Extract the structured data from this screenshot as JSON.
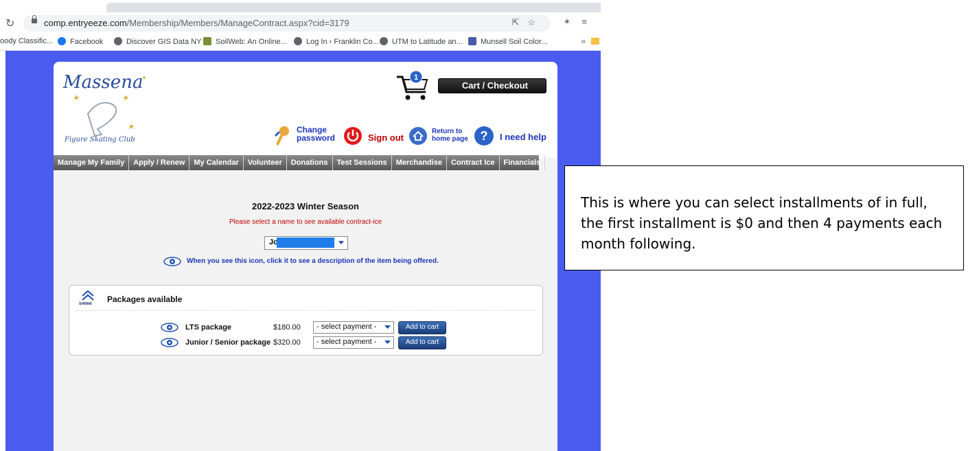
{
  "browser": {
    "url_domain": "comp.entryeeze.com",
    "url_path": "/Membership/Members/ManageContract.aspx?cid=3179",
    "bookmarks": [
      {
        "label": "oody Classific...",
        "icon": "none"
      },
      {
        "label": "Facebook",
        "icon": "facebook-icon"
      },
      {
        "label": "Discover GIS Data NY",
        "icon": "globe-icon"
      },
      {
        "label": "SoilWeb: An Online...",
        "icon": "soilweb-icon"
      },
      {
        "label": "Log In ‹ Franklin Co...",
        "icon": "globe-icon"
      },
      {
        "label": "UTM to Latitude an...",
        "icon": "globe-icon"
      },
      {
        "label": "Munsell Soil Color...",
        "icon": "munsell-icon"
      }
    ],
    "more": "»"
  },
  "site": {
    "logo_text": "Massena",
    "logo_subtext": "Figure Skating Club",
    "cart_count": "1",
    "cart_checkout": "Cart / Checkout",
    "header_links": {
      "change_password": [
        "Change",
        "password"
      ],
      "sign_out": "Sign out",
      "return_home": [
        "Return to",
        "home page"
      ],
      "help": "I need help"
    },
    "nav": [
      "Manage My Family",
      "Apply / Renew",
      "My Calendar",
      "Volunteer",
      "Donations",
      "Test Sessions",
      "Merchandise",
      "Contract Ice",
      "Financials"
    ]
  },
  "main": {
    "season_title": "2022-2023 Winter Season",
    "prompt": "Please select a name to see available contract-ice",
    "name_select_value": "Jo",
    "eye_hint": "When you see this icon, click it to see a description of the item being offered.",
    "packages": {
      "title": "Packages available",
      "shrink_label": "SHRINK",
      "items": [
        {
          "name": "LTS package",
          "price": "$180.00",
          "payment": "- select payment -",
          "button": "Add to cart"
        },
        {
          "name": "Junior / Senior package",
          "price": "$320.00",
          "payment": "- select payment -",
          "button": "Add to cart"
        }
      ]
    }
  },
  "annotation": {
    "text": "This is where you can select installments of in full, the first installment is $0 and then 4 payments each month following."
  },
  "colors": {
    "page_background": "#4a5bef",
    "nav_bar": "#666666",
    "prompt_red": "#c00000",
    "hint_blue": "#1d34b8",
    "button_blue": "#2a549a",
    "redaction": "#1e7de8"
  }
}
